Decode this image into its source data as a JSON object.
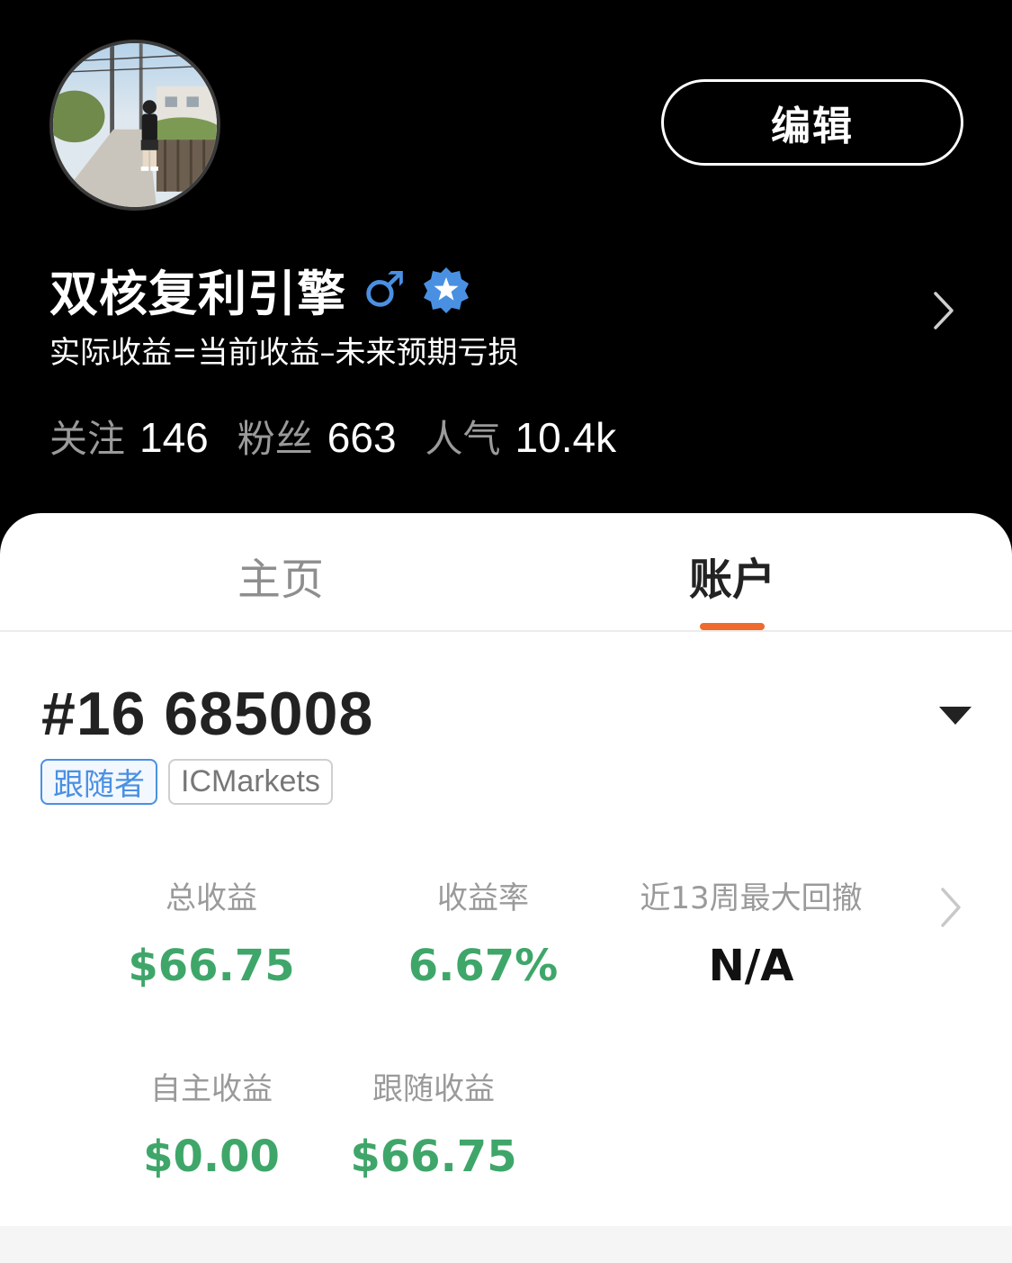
{
  "header": {
    "edit_label": "编辑",
    "username": "双核复利引擎",
    "gender_symbol": "♂",
    "bio": "实际收益=当前收益–未来预期亏损",
    "stats": [
      {
        "label": "关注",
        "value": "146"
      },
      {
        "label": "粉丝",
        "value": "663"
      },
      {
        "label": "人气",
        "value": "10.4k"
      }
    ]
  },
  "tabs": {
    "home": "主页",
    "account": "账户",
    "active": "account"
  },
  "account": {
    "id": "#16 685008",
    "tags": [
      "跟随者",
      "ICMarkets"
    ]
  },
  "metrics": {
    "total_profit": {
      "label": "总收益",
      "value": "$66.75"
    },
    "return_rate": {
      "label": "收益率",
      "value": "6.67%"
    },
    "max_drawdown": {
      "label": "近13周最大回撤",
      "value": "N/A"
    },
    "self_profit": {
      "label": "自主收益",
      "value": "$0.00"
    },
    "follow_profit": {
      "label": "跟随收益",
      "value": "$66.75"
    }
  },
  "colors": {
    "accent": "#ee6b2d",
    "profit_green": "#3fa66a",
    "tag_blue": "#4a90e2",
    "header_bg": "#000000"
  }
}
